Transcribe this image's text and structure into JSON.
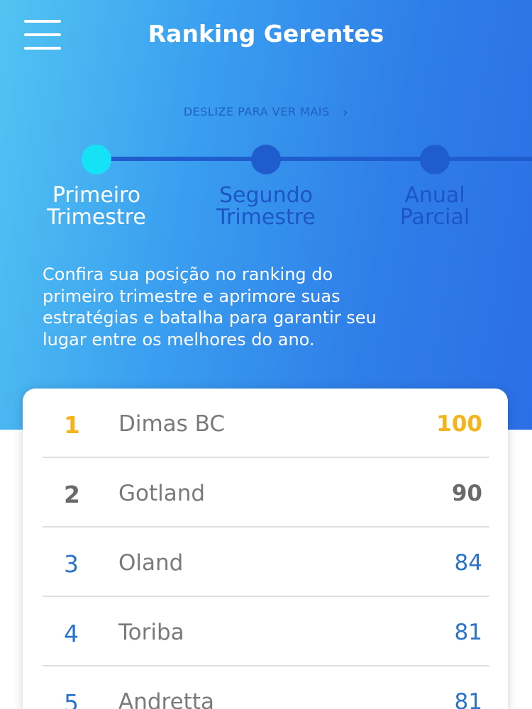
{
  "header": {
    "title": "Ranking Gerentes",
    "menu_icon": "hamburger-menu-icon"
  },
  "swipe_hint": {
    "text": "DESLIZE PARA VER MAIS",
    "icon": "chevron-right-icon"
  },
  "periods": [
    {
      "label": "Primeiro\nTrimestre",
      "active": true
    },
    {
      "label": "Segundo\nTrimestre",
      "active": false
    },
    {
      "label": "Anual\nParcial",
      "active": false
    }
  ],
  "intro_text": "Confira sua posição no ranking do\nprimeiro trimestre e aprimore suas\nestratégias e batalha para garantir seu\nlugar entre os melhores do ano.",
  "ranking": [
    {
      "rank": "1",
      "name": "Dimas BC",
      "score": "100"
    },
    {
      "rank": "2",
      "name": "Gotland",
      "score": "90"
    },
    {
      "rank": "3",
      "name": "Oland",
      "score": "84"
    },
    {
      "rank": "4",
      "name": "Toriba",
      "score": "81"
    },
    {
      "rank": "5",
      "name": "Andretta",
      "score": "81"
    }
  ],
  "colors": {
    "gradient_start": "#52c4f2",
    "gradient_end": "#2b6fe6",
    "active_step": "#15e3f5",
    "inactive_step": "#1f5ccd",
    "first_place": "#f5b31c",
    "second_place": "#6a6a6a",
    "other_places": "#2a73cc"
  }
}
